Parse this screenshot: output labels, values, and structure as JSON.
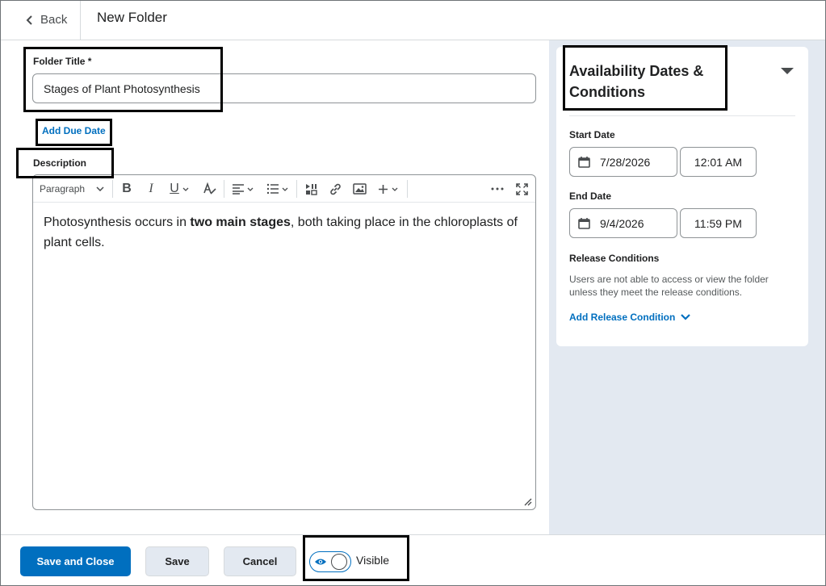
{
  "header": {
    "back_label": "Back",
    "page_title": "New Folder"
  },
  "form": {
    "folder_title_label": "Folder Title *",
    "folder_title_value": "Stages of Plant Photosynthesis",
    "add_due_date": "Add Due Date",
    "description_label": "Description",
    "toolbar": {
      "paragraph_label": "Paragraph",
      "more_label": "···"
    },
    "description": {
      "part1": "Photosynthesis occurs in ",
      "bold": "two main stages",
      "part2": ", both taking place in the chloroplasts of plant cells."
    }
  },
  "availability": {
    "title": "Availability Dates & Conditions",
    "start_date_label": "Start Date",
    "start_date": "7/28/2026",
    "start_time": "12:01 AM",
    "end_date_label": "End Date",
    "end_date": "9/4/2026",
    "end_time": "11:59 PM",
    "release_conditions_label": "Release Conditions",
    "release_help": "Users are not able to access or view the folder unless they meet the release conditions.",
    "add_release_condition": "Add Release Condition"
  },
  "footer": {
    "save_and_close": "Save and Close",
    "save": "Save",
    "cancel": "Cancel",
    "visible_label": "Visible",
    "visible_on": true
  },
  "colors": {
    "accent": "#006fbf",
    "panel_bg": "#e3e9f1",
    "text": "#202122"
  }
}
